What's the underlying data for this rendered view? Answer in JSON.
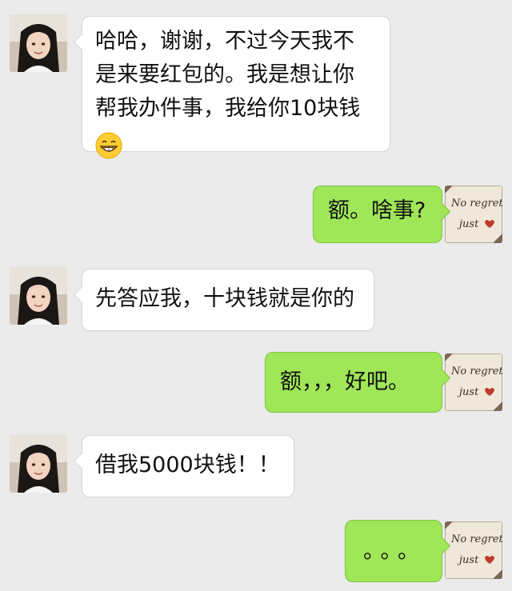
{
  "conversation": {
    "messages": [
      {
        "side": "incoming",
        "lines": [
          "哈哈，谢谢，不过今天我不",
          "是来要红包的。我是想让你",
          "帮我办件事，我给你10块钱"
        ],
        "emoji": "grinning-face-icon"
      },
      {
        "side": "outgoing",
        "text": "额。啥事?"
      },
      {
        "side": "incoming",
        "text": "先答应我，十块钱就是你的"
      },
      {
        "side": "outgoing",
        "text": "额，，，好吧。"
      },
      {
        "side": "incoming",
        "text": "借我5000块钱！！"
      },
      {
        "side": "outgoing",
        "text": "。。。"
      }
    ],
    "self_avatar_text": {
      "line1": "No regrets",
      "line2": "just"
    },
    "colors": {
      "background": "#ebebeb",
      "outgoing_bubble": "#9fe658",
      "incoming_bubble": "#ffffff"
    }
  }
}
